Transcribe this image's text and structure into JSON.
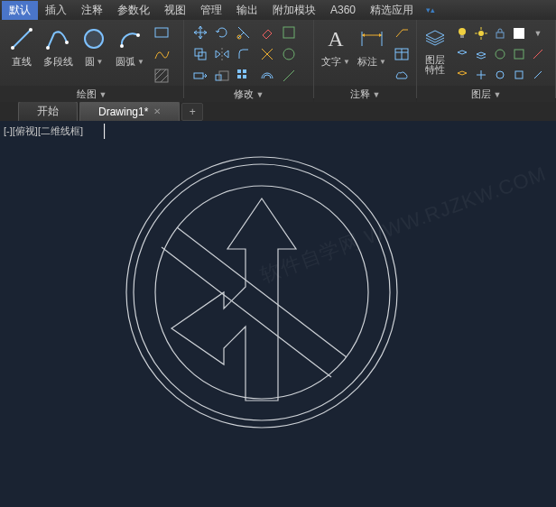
{
  "menubar": {
    "items": [
      {
        "label": "默认",
        "active": true
      },
      {
        "label": "插入"
      },
      {
        "label": "注释"
      },
      {
        "label": "参数化"
      },
      {
        "label": "视图"
      },
      {
        "label": "管理"
      },
      {
        "label": "输出"
      },
      {
        "label": "附加模块"
      },
      {
        "label": "A360"
      },
      {
        "label": "精选应用"
      }
    ]
  },
  "ribbon": {
    "panels": {
      "draw": {
        "title": "绘图",
        "buttons": {
          "line": "直线",
          "polyline": "多段线",
          "circle": "圆",
          "arc": "圆弧"
        }
      },
      "modify": {
        "title": "修改"
      },
      "annotate": {
        "title": "注释",
        "text": "文字",
        "dim": "标注"
      },
      "layers": {
        "title": "图层",
        "props": "图层\n特性"
      }
    }
  },
  "tabs": {
    "start": "开始",
    "drawing": "Drawing1*"
  },
  "viewport": {
    "label": "[-][俯视][二维线框]"
  },
  "watermark": "软件自学网 WWW.RJZKW.COM"
}
